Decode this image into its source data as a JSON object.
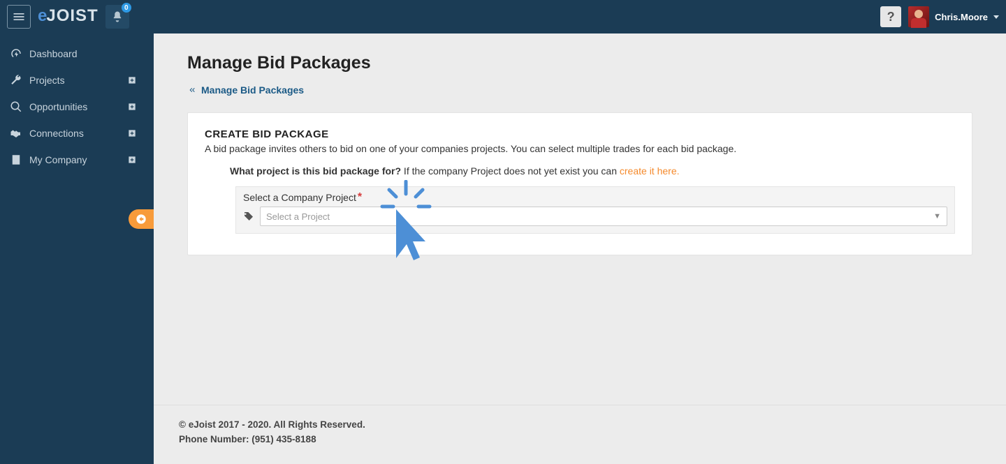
{
  "brand": {
    "part1": "e",
    "part2": "JOIST"
  },
  "topbar": {
    "notif_count": "0",
    "help_symbol": "?",
    "username": "Chris.Moore"
  },
  "sidebar": {
    "items": [
      {
        "id": "dashboard",
        "label": "Dashboard",
        "expandable": false
      },
      {
        "id": "projects",
        "label": "Projects",
        "expandable": true
      },
      {
        "id": "opportunities",
        "label": "Opportunities",
        "expandable": true
      },
      {
        "id": "connections",
        "label": "Connections",
        "expandable": true
      },
      {
        "id": "mycompany",
        "label": "My Company",
        "expandable": true
      }
    ]
  },
  "page": {
    "title": "Manage Bid Packages",
    "breadcrumb_label": "Manage Bid Packages"
  },
  "card": {
    "heading": "CREATE BID PACKAGE",
    "description": "A bid package invites others to bid on one of your companies projects. You can select multiple trades for each bid package.",
    "question_bold": "What project is this bid package for?",
    "question_rest": " If the company Project does not yet exist you can ",
    "create_link": "create it here.",
    "field_label": "Select a Company Project",
    "select_placeholder": "Select a Project"
  },
  "footer": {
    "line1": "© eJoist 2017 - 2020. All Rights Reserved.",
    "line2": "Phone Number: (951) 435-8188"
  },
  "colors": {
    "brand_blue": "#4d8fd6",
    "dark_nav": "#1b3c55",
    "accent_orange": "#f89b3a",
    "link_orange": "#f58a2c",
    "badge_blue": "#2e9ae6"
  }
}
